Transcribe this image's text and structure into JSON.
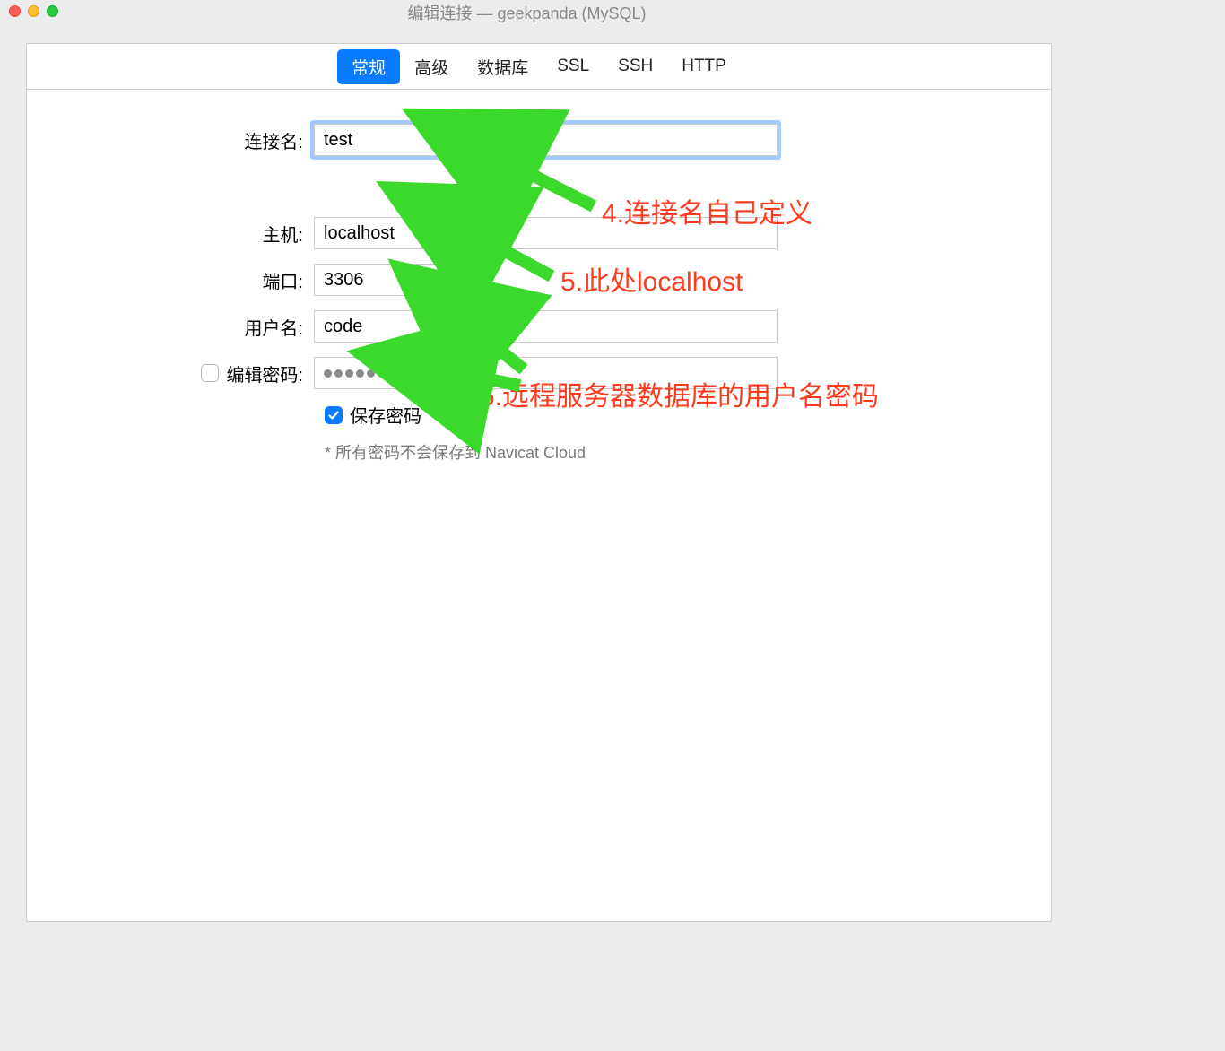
{
  "window": {
    "title": "编辑连接 — geekpanda (MySQL)"
  },
  "tabs": {
    "general": "常规",
    "advanced": "高级",
    "database": "数据库",
    "ssl": "SSL",
    "ssh": "SSH",
    "http": "HTTP"
  },
  "labels": {
    "connection": "连接名:",
    "host": "主机:",
    "port": "端口:",
    "username": "用户名:",
    "edit_password": "编辑密码:",
    "save_password": "保存密码",
    "hint": "* 所有密码不会保存到 Navicat Cloud"
  },
  "values": {
    "connection": "test",
    "host": "localhost",
    "port": "3306",
    "username": "code",
    "password_dots": 8
  },
  "annotations": {
    "a4": "4.连接名自己定义",
    "a5": "5.此处localhost",
    "a6": "6.远程服务器数据库的用户名密码"
  },
  "colors": {
    "accent": "#0a7bff",
    "annot": "#ff3b1f",
    "arrow": "#3bd92c"
  }
}
